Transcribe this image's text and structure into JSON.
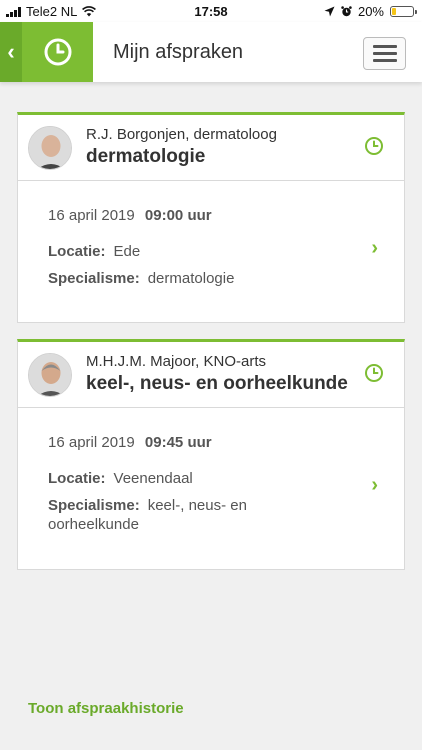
{
  "status_bar": {
    "carrier": "Tele2 NL",
    "time": "17:58",
    "battery": "20%",
    "battery_level": 0.2
  },
  "header": {
    "title": "Mijn afspraken",
    "back_icon": "chevron-left-icon",
    "section_icon": "clock-icon",
    "menu_icon": "hamburger-icon"
  },
  "colors": {
    "accent": "#7dbd33",
    "accent_dark": "#6aaa2a",
    "background": "#f0f0f0"
  },
  "labels": {
    "location": "Locatie:",
    "specialism": "Specialisme:"
  },
  "appointments": [
    {
      "doctor": "R.J. Borgonjen, dermatoloog",
      "specialty_title": "dermatologie",
      "date": "16 april 2019",
      "time": "09:00 uur",
      "location": "Ede",
      "specialism": "dermatologie"
    },
    {
      "doctor": "M.H.J.M. Majoor, KNO-arts",
      "specialty_title": "keel-, neus- en oorheelkunde",
      "date": "16 april 2019",
      "time": "09:45 uur",
      "location": "Veenendaal",
      "specialism": "keel-, neus- en oorheelkunde"
    }
  ],
  "footer": {
    "history_link": "Toon afspraakhistorie"
  }
}
